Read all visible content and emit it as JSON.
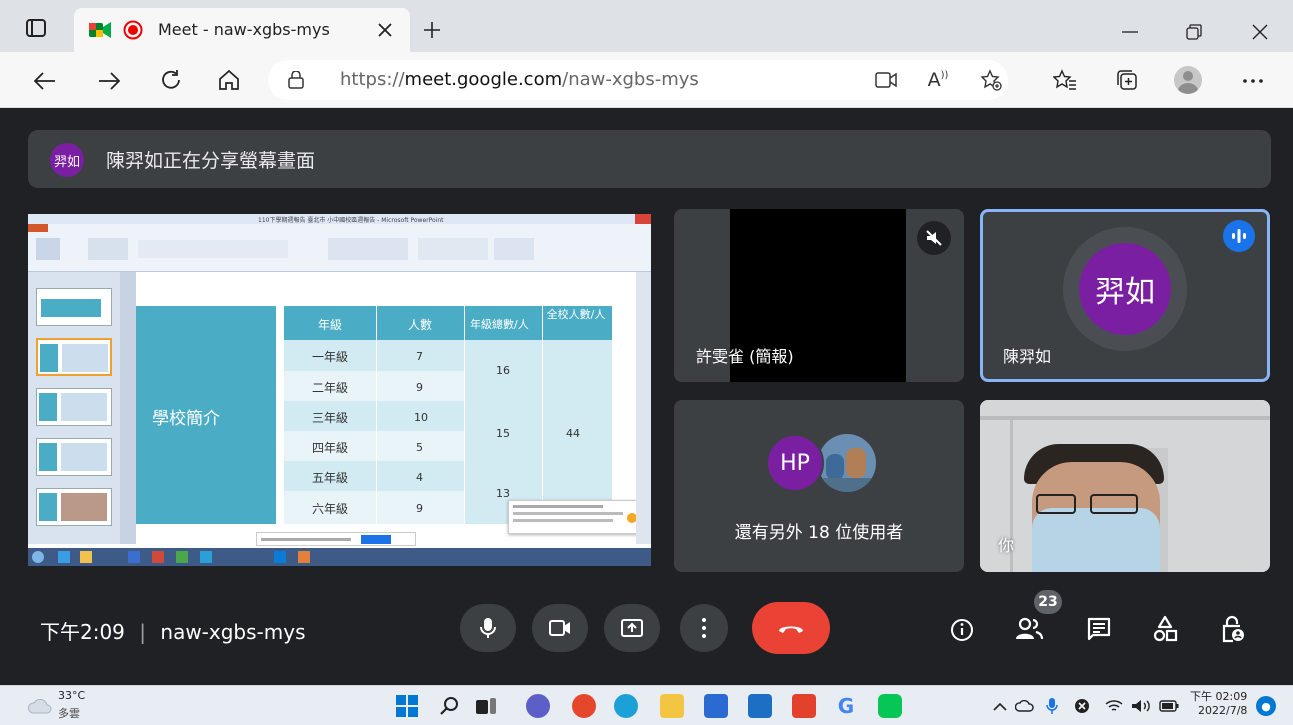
{
  "browser": {
    "tab_title": "Meet - naw-xgbs-mys",
    "url_prefix": "https://",
    "url_host": "meet.google.com",
    "url_path": "/naw-xgbs-mys"
  },
  "banner": {
    "avatar_text": "羿如",
    "message": "陳羿如正在分享螢幕畫面"
  },
  "slide": {
    "ppt_title": "110下學期週報告 臺北市 小中國校區週報告 - Microsoft PowerPoint",
    "heading": "學校簡介",
    "table_headers": [
      "年級",
      "人數",
      "年級總數/人",
      "全校人數/人"
    ],
    "rows": [
      {
        "grade": "一年級",
        "count": "7"
      },
      {
        "grade": "二年級",
        "count": "9"
      },
      {
        "grade": "三年級",
        "count": "10"
      },
      {
        "grade": "四年級",
        "count": "5"
      },
      {
        "grade": "五年級",
        "count": "4"
      },
      {
        "grade": "六年級",
        "count": "9"
      }
    ],
    "group_totals": [
      "16",
      "15",
      "13"
    ],
    "school_total": "44"
  },
  "tiles": {
    "presenter_name": "許雯雀 (簡報)",
    "sharer_name": "陳羿如",
    "sharer_avatar": "羿如",
    "others_avatar": "HP",
    "others_text": "還有另外 18 位使用者",
    "self_label": "你"
  },
  "controls": {
    "time": "下午2:09",
    "separator": "|",
    "meeting_code": "naw-xgbs-mys",
    "people_count": "23"
  },
  "taskbar": {
    "temp": "33°C",
    "weather": "多雲",
    "clock_time": "下午 02:09",
    "clock_date": "2022/7/8"
  },
  "colors": {
    "accent_purple": "#7b1fa2",
    "meet_bg": "#202124",
    "tile_bg": "#3c4043",
    "end_call_red": "#ea4335",
    "active_speaker_blue": "#8ab4f8"
  }
}
